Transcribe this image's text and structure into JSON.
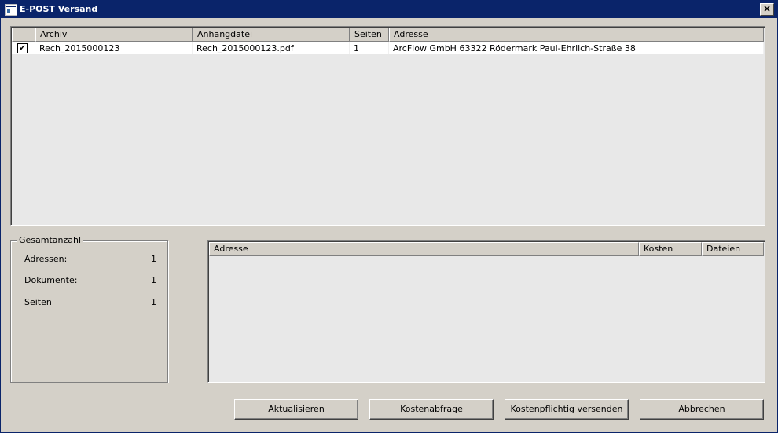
{
  "window": {
    "title": "E-POST Versand",
    "close_label": "×"
  },
  "top_table": {
    "columns": [
      "",
      "Archiv",
      "Anhangdatei",
      "Seiten",
      "Adresse"
    ],
    "rows": [
      {
        "checked": "✔",
        "archiv": "Rech_2015000123",
        "anhangdatei": "Rech_2015000123.pdf",
        "seiten": "1",
        "adresse": "ArcFlow GmbH 63322 Rödermark Paul-Ehrlich-Straße 38"
      }
    ]
  },
  "summary": {
    "title": "Gesamtanzahl",
    "items": [
      {
        "label": "Adressen:",
        "value": "1"
      },
      {
        "label": "Dokumente:",
        "value": "1"
      },
      {
        "label": "Seiten",
        "value": "1"
      }
    ]
  },
  "cost_table": {
    "columns": [
      "Adresse",
      "Kosten",
      "Dateien"
    ]
  },
  "buttons": {
    "refresh": "Aktualisieren",
    "cost_query": "Kostenabfrage",
    "send": "Kostenpflichtig versenden",
    "cancel": "Abbrechen"
  }
}
